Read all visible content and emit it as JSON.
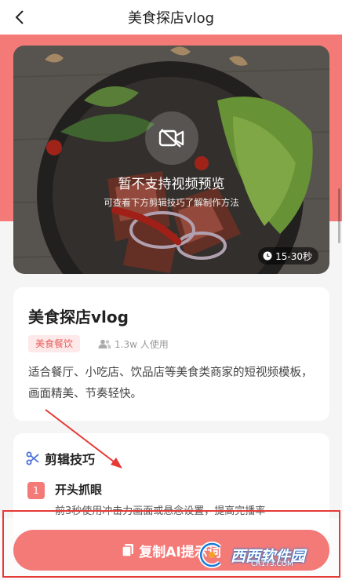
{
  "header": {
    "title": "美食探店vlog"
  },
  "preview": {
    "message": "暂不支持视频预览",
    "sub_message": "可查看下方剪辑技巧了解制作方法",
    "duration": "15-30秒"
  },
  "info": {
    "title": "美食探店vlog",
    "tag": "美食餐饮",
    "users": "1.3w 人使用",
    "description": "适合餐厅、小吃店、饮品店等美食类商家的短视频模板，画面精美、节奏轻快。"
  },
  "tips": {
    "title": "剪辑技巧",
    "steps": [
      {
        "num": "1",
        "title": "开头抓眼",
        "desc": "前3秒使用冲击力画面或悬念设置，提高完播率"
      }
    ]
  },
  "cta": {
    "label": "复制AI提示词"
  },
  "watermark": {
    "brand": "西西软件园",
    "site": "CR173.COM"
  },
  "colors": {
    "accent": "#f47a78",
    "tag_bg": "#fde9e9",
    "annotation": "#e53a36"
  }
}
